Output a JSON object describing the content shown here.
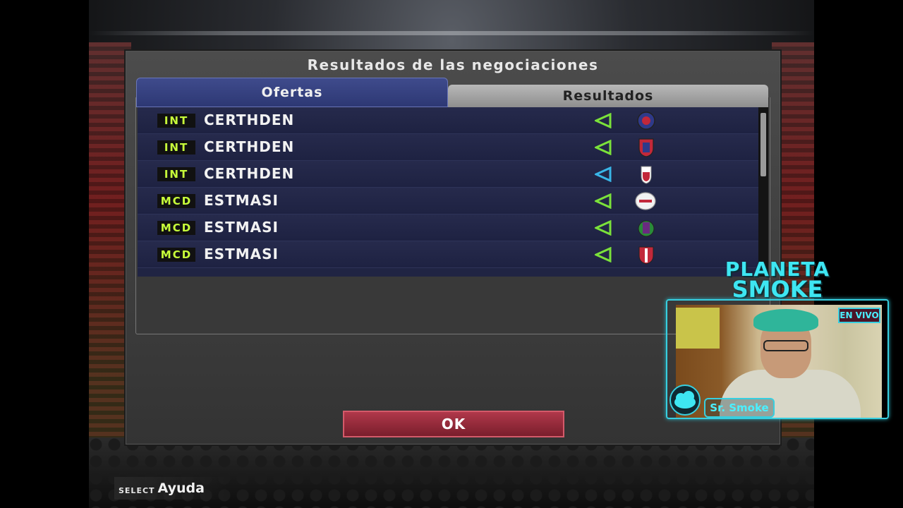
{
  "dialog": {
    "title": "Resultados de las negociaciones",
    "tabs": [
      {
        "label": "Ofertas",
        "active": true
      },
      {
        "label": "Resultados",
        "active": false
      }
    ],
    "rows": [
      {
        "position": "INT",
        "player": "CERTHDEN",
        "arrow_color": "#7be23a",
        "crest": "crest-1",
        "crest_colors": [
          "#2f3a8a",
          "#c2283a"
        ]
      },
      {
        "position": "INT",
        "player": "CERTHDEN",
        "arrow_color": "#7be23a",
        "crest": "crest-2",
        "crest_colors": [
          "#c2283a",
          "#2f3a8a"
        ]
      },
      {
        "position": "INT",
        "player": "CERTHDEN",
        "arrow_color": "#39b6e8",
        "crest": "crest-3",
        "crest_colors": [
          "#ffffff",
          "#c2283a"
        ]
      },
      {
        "position": "MCD",
        "player": "ESTMASI",
        "arrow_color": "#7be23a",
        "crest": "crest-4",
        "crest_colors": [
          "#f2f2f2",
          "#c2283a"
        ]
      },
      {
        "position": "MCD",
        "player": "ESTMASI",
        "arrow_color": "#7be23a",
        "crest": "crest-5",
        "crest_colors": [
          "#6a2a80",
          "#2a8a3a"
        ]
      },
      {
        "position": "MCD",
        "player": "ESTMASI",
        "arrow_color": "#7be23a",
        "crest": "crest-6",
        "crest_colors": [
          "#c2283a",
          "#ffffff"
        ]
      }
    ],
    "ok_label": "OK"
  },
  "help": {
    "key": "SELECT",
    "label": "Ayuda"
  },
  "overlay": {
    "title_line1": "PLANETA",
    "title_line2": "SMOKE",
    "live_badge": "EN VIVO",
    "streamer_name": "Sr. Smoke",
    "accent": "#3ee6f2"
  }
}
